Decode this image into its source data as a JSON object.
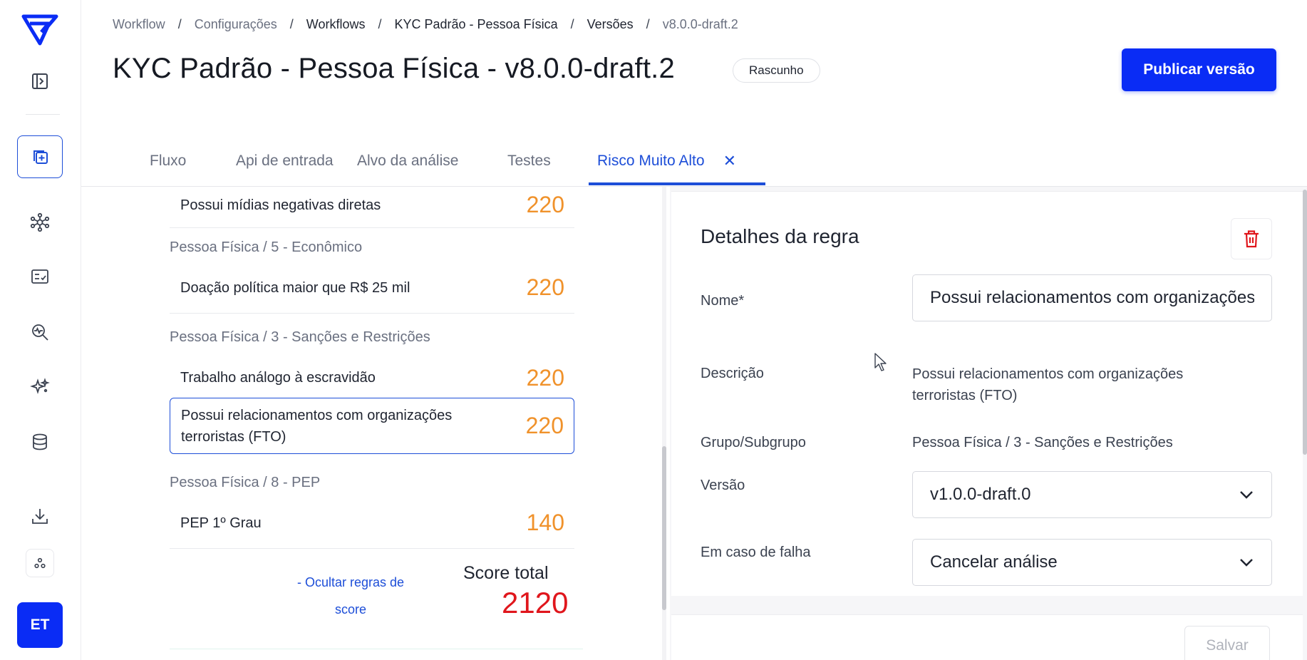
{
  "sidebar": {
    "avatar_initials": "ET"
  },
  "breadcrumb": [
    {
      "label": "Workflow",
      "muted": false
    },
    {
      "label": "Configurações",
      "muted": false
    },
    {
      "label": "Workflows",
      "muted": false
    },
    {
      "label": "KYC Padrão - Pessoa Física",
      "muted": false
    },
    {
      "label": "Versões",
      "muted": false
    },
    {
      "label": "v8.0.0-draft.2",
      "muted": true
    }
  ],
  "breadcrumb_separator": "/",
  "header": {
    "title": "KYC Padrão - Pessoa Física - v8.0.0-draft.2",
    "status_badge": "Rascunho",
    "publish_label": "Publicar versão"
  },
  "tabs": [
    {
      "label": "Fluxo",
      "active": false
    },
    {
      "label": "Api de entrada",
      "active": false
    },
    {
      "label": "Alvo da análise",
      "active": false
    },
    {
      "label": "Testes",
      "active": false
    },
    {
      "label": "Risco Muito Alto",
      "active": true
    }
  ],
  "rules": {
    "items": [
      {
        "group": "",
        "name": "Possui mídias negativas diretas",
        "score": "220"
      },
      {
        "group": "Pessoa Física / 5 - Econômico",
        "name": "Doação política maior que R$ 25 mil",
        "score": "220"
      },
      {
        "group": "Pessoa Física / 3 - Sanções e Restrições",
        "name": "Trabalho análogo à escravidão",
        "score": "220"
      },
      {
        "group": "",
        "name": "Possui relacionamentos com organizações terroristas (FTO)",
        "score": "220",
        "selected": true
      },
      {
        "group": "Pessoa Física / 8 - PEP",
        "name": "PEP 1º Grau",
        "score": "140"
      }
    ],
    "hide_rules_link": "- Ocultar regras de score",
    "score_total_label": "Score total",
    "score_total_value": "2120"
  },
  "details": {
    "title": "Detalhes da regra",
    "name_label": "Nome*",
    "name_value": "Possui relacionamentos com organizações terroristas (FTO)",
    "description_label": "Descrição",
    "description_value": "Possui relacionamentos com organizações terroristas (FTO)",
    "group_label": "Grupo/Subgrupo",
    "group_value": "Pessoa Física / 3 - Sanções e Restrições",
    "version_label": "Versão",
    "version_value": "v1.0.0-draft.0",
    "failure_label": "Em caso de falha",
    "failure_value": "Cancelar análise",
    "save_label": "Salvar"
  },
  "colors": {
    "accent": "#0a2cf5",
    "link": "#1d4ed8",
    "score_orange": "#f0922b",
    "score_total_red": "#e0161c",
    "delete_red": "#e0161c"
  }
}
